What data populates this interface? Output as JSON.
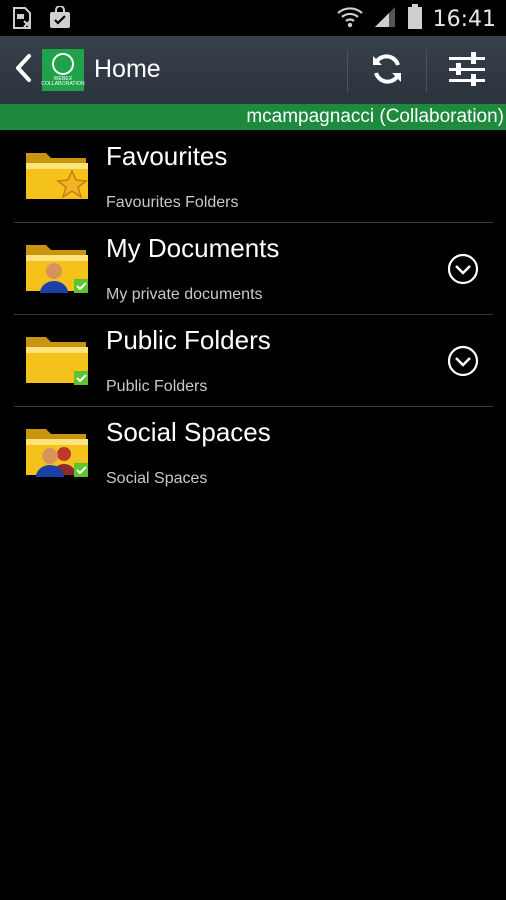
{
  "status_bar": {
    "time": "16:41",
    "icons": [
      "sim-missing-icon",
      "shopping-bag-icon",
      "wifi-icon",
      "signal-icon",
      "battery-icon"
    ]
  },
  "action_bar": {
    "title": "Home",
    "logo_text_line1": "WEBEX",
    "logo_text_line2": "COLLABORATION",
    "icons": [
      "back-arrow-icon",
      "refresh-icon",
      "settings-sliders-icon"
    ]
  },
  "user_strip": {
    "text": "mcampagnacci (Collaboration)",
    "color": "#1d8a3e"
  },
  "list": [
    {
      "title": "Favourites",
      "subtitle": "Favourites Folders",
      "icon": "folder-star-icon",
      "expandable": false
    },
    {
      "title": "My Documents",
      "subtitle": "My private documents",
      "icon": "folder-user-icon",
      "expandable": true
    },
    {
      "title": "Public Folders",
      "subtitle": "Public Folders",
      "icon": "folder-shared-icon",
      "expandable": true
    },
    {
      "title": "Social Spaces",
      "subtitle": "Social Spaces",
      "icon": "folder-group-icon",
      "expandable": false
    }
  ],
  "colors": {
    "folder": "#f5c21b",
    "check": "#5cc431",
    "action_bar": "#323b44"
  }
}
